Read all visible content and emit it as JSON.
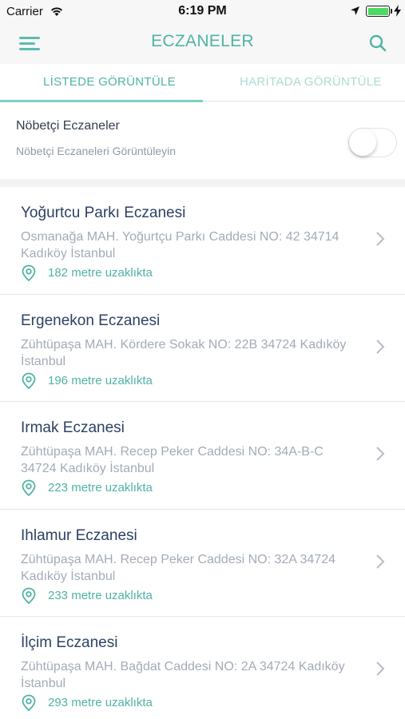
{
  "status": {
    "carrier": "Carrier",
    "time": "6:19 PM"
  },
  "header": {
    "title": "ECZANELER"
  },
  "tabs": [
    {
      "label": "LİSTEDE GÖRÜNTÜLE",
      "active": true
    },
    {
      "label": "HARİTADA GÖRÜNTÜLE",
      "active": false
    }
  ],
  "duty": {
    "title": "Nöbetçi Eczaneler",
    "subtitle": "Nöbetçi Eczaneleri Görüntüleyin",
    "enabled": false
  },
  "pharmacies": [
    {
      "name": "Yoğurtcu Parkı Eczanesi",
      "address": "Osmanağa MAH. Yoğurtçu Parkı Caddesi NO: 42 34714 Kadıköy İstanbul",
      "distance": "182 metre uzaklıkta"
    },
    {
      "name": "Ergenekon Eczanesi",
      "address": "Zühtüpaşa MAH. Kördere Sokak NO: 22B 34724 Kadıköy İstanbul",
      "distance": "196 metre uzaklıkta"
    },
    {
      "name": "Irmak Eczanesi",
      "address": "Zühtüpaşa MAH. Recep Peker Caddesi NO: 34A-B-C 34724 Kadıköy İstanbul",
      "distance": "223 metre uzaklıkta"
    },
    {
      "name": "Ihlamur Eczanesi",
      "address": "Zühtüpaşa MAH. Recep Peker Caddesi NO: 32A 34724 Kadıköy İstanbul",
      "distance": "233 metre uzaklıkta"
    },
    {
      "name": "İlçim Eczanesi",
      "address": "Zühtüpaşa MAH. Bağdat Caddesi NO: 2A 34724 Kadıköy İstanbul",
      "distance": "293 metre uzaklıkta"
    }
  ],
  "icons": {
    "menu": "menu-icon",
    "search": "search-icon",
    "pin": "location-pin-icon",
    "chevron": "chevron-right-icon"
  },
  "colors": {
    "accent": "#4fb3a5",
    "title": "#2d4163",
    "muted": "#a3abb7"
  }
}
